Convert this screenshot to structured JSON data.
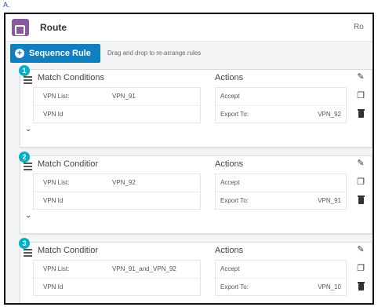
{
  "option_label": "A.",
  "header": {
    "title": "Route",
    "right_text": "Ro"
  },
  "toolbar": {
    "sequence_rule_label": "Sequence Rule",
    "hint": "Drag and drop to re-arrange rules"
  },
  "sequences": [
    {
      "number": "1",
      "match_title": "Match Conditions",
      "actions_title": "Actions",
      "conditions": [
        {
          "key": "VPN List:",
          "value": "VPN_91"
        },
        {
          "key": "VPN Id",
          "value": ""
        }
      ],
      "actions": [
        {
          "key": "Accept",
          "value": ""
        },
        {
          "key": "Export To:",
          "value": "VPN_92"
        }
      ]
    },
    {
      "number": "2",
      "match_title": "Match Conditior",
      "actions_title": "Actions",
      "conditions": [
        {
          "key": "VPN List:",
          "value": "VPN_92"
        },
        {
          "key": "VPN Id",
          "value": ""
        }
      ],
      "actions": [
        {
          "key": "Accept",
          "value": ""
        },
        {
          "key": "Export To:",
          "value": "VPN_91"
        }
      ]
    },
    {
      "number": "3",
      "match_title": "Match Conditior",
      "actions_title": "Actions",
      "conditions": [
        {
          "key": "VPN List:",
          "value": "VPN_91_and_VPN_92"
        },
        {
          "key": "VPN Id",
          "value": ""
        }
      ],
      "actions": [
        {
          "key": "Accept",
          "value": ""
        },
        {
          "key": "Export To:",
          "value": "VPN_10"
        }
      ]
    }
  ],
  "icons": {
    "edit": "pencil-icon",
    "copy": "copy-icon",
    "delete": "trash-icon",
    "expand": "chevron-down-icon",
    "drag": "drag-handle-icon"
  },
  "colors": {
    "accent": "#0f7fbf",
    "badge": "#00b0c6",
    "route_icon": "#8a5a9e"
  }
}
